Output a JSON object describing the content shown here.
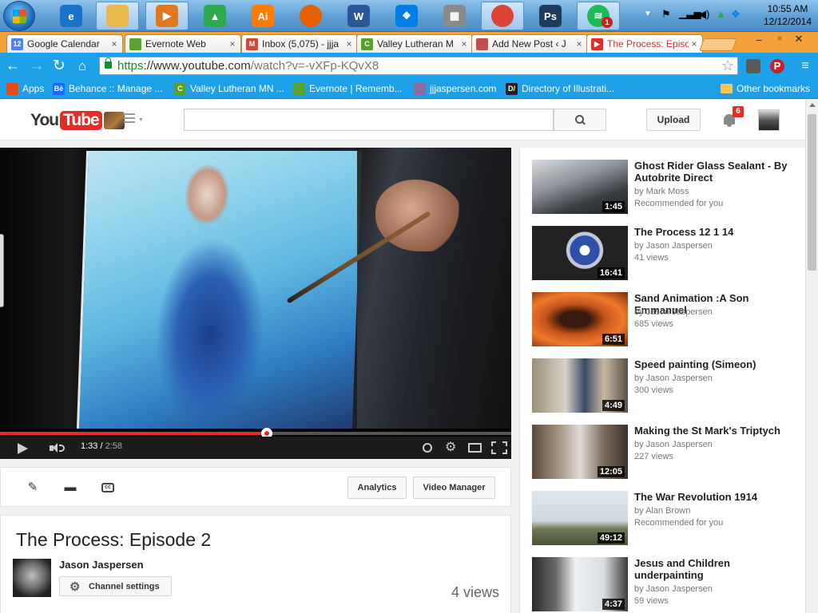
{
  "taskbar": {
    "apps": [
      {
        "name": "ie-icon",
        "glyph": "e",
        "color": "#1a73c8"
      },
      {
        "name": "explorer-icon",
        "glyph": "",
        "color": "#e8b84a"
      },
      {
        "name": "media-player-icon",
        "glyph": "▶",
        "color": "#e07820"
      },
      {
        "name": "google-drive-icon",
        "glyph": "▲",
        "color": "#2da94f"
      },
      {
        "name": "illustrator-icon",
        "glyph": "Ai",
        "color": "#ff7c00"
      },
      {
        "name": "firefox-icon",
        "glyph": "",
        "color": "#e66000"
      },
      {
        "name": "word-icon",
        "glyph": "W",
        "color": "#2b579a"
      },
      {
        "name": "dropbox-icon",
        "glyph": "❖",
        "color": "#007ee5"
      },
      {
        "name": "calculator-icon",
        "glyph": "▦",
        "color": "#8a8a8a"
      },
      {
        "name": "chrome-icon",
        "glyph": "",
        "color": "#db4437"
      },
      {
        "name": "photoshop-icon",
        "glyph": "Ps",
        "color": "#1f3c5c"
      },
      {
        "name": "spotify-icon",
        "glyph": "≋",
        "color": "#1db954"
      }
    ],
    "spotify_badge": "1",
    "clock_time": "10:55 AM",
    "clock_date": "12/12/2014"
  },
  "tabs": [
    {
      "label": "Google Calendar",
      "favicon": "12",
      "color": "#4a86e8"
    },
    {
      "label": "Evernote Web",
      "favicon": "",
      "color": "#58a52e"
    },
    {
      "label": "Inbox (5,075) - jjja",
      "favicon": "M",
      "color": "#d44638"
    },
    {
      "label": "Valley Lutheran M",
      "favicon": "C",
      "color": "#5aa02c"
    },
    {
      "label": "Add New Post ‹ J",
      "favicon": "",
      "color": "#c0504d"
    },
    {
      "label": "The Process: Episo",
      "favicon": "▶",
      "color": "#e52d27",
      "active": true
    }
  ],
  "toolbar": {
    "url_scheme": "https",
    "url_rest": "://www.youtube.com",
    "url_path": "/watch?v=-vXFp-KQvX8"
  },
  "bookmarks": [
    {
      "label": "Apps",
      "favicon": "",
      "color": "#e64a19"
    },
    {
      "label": "Behance :: Manage ...",
      "favicon": "Bē",
      "color": "#1769ff"
    },
    {
      "label": "Valley Lutheran MN ...",
      "favicon": "C",
      "color": "#5aa02c"
    },
    {
      "label": "Evernote | Rememb...",
      "favicon": "",
      "color": "#58a52e"
    },
    {
      "label": "jjjaspersen.com",
      "favicon": "",
      "color": "#8a6d9c"
    },
    {
      "label": "Directory of Illustrati...",
      "favicon": "D/",
      "color": "#222222"
    }
  ],
  "other_bookmarks": "Other bookmarks",
  "youtube": {
    "logo_you": "You",
    "logo_tube": "Tube",
    "search_placeholder": "",
    "upload_label": "Upload",
    "notification_count": "6"
  },
  "player": {
    "current_time": "1:33",
    "duration": "2:58",
    "progress_fraction": 0.522
  },
  "actions": {
    "analytics_label": "Analytics",
    "video_manager_label": "Video Manager"
  },
  "video": {
    "title": "The Process: Episode 2",
    "channel": "Jason Jaspersen",
    "channel_settings_label": "Channel settings",
    "views": "4 views"
  },
  "recommendations": [
    {
      "title": "Ghost Rider Glass Sealant - By Autobrite Direct",
      "channel": "by Mark Moss",
      "meta": "Recommended for you",
      "duration": "1:45",
      "thumb": "linear-gradient(160deg,#d9dde0 0%,#8c9299 40%,#3b3f44 70%,#1b1d20 100%)"
    },
    {
      "title": "The Process 12 1 14",
      "channel": "by Jason Jaspersen",
      "meta": "41 views",
      "duration": "16:41",
      "thumb": "radial-gradient(circle at 55% 45%,#fff 0 8%,#2f4fa8 9% 24%,#c2c8d8 25% 30%,#222 31%)"
    },
    {
      "title": "Sand Animation :A Son Emmanuel",
      "channel": "by Jason Jaspersen",
      "meta": "685 views",
      "duration": "6:51",
      "thumb": "radial-gradient(ellipse at 45% 50%,#3a1a0c 0 20%,#c2531c 40%,#f07a2a 65%,#7a2a0c 100%)"
    },
    {
      "title": "Speed painting (Simeon)",
      "channel": "by Jason Jaspersen",
      "meta": "300 views",
      "duration": "4:49",
      "thumb": "linear-gradient(90deg,#9c8f7c 0%,#d8d2c4 35%,#3a4a66 55%,#c8b8a0 75%,#5c5044 100%)"
    },
    {
      "title": "Making the St Mark's Triptych",
      "channel": "by Jason Jaspersen",
      "meta": "227 views",
      "duration": "12:05",
      "thumb": "linear-gradient(90deg,#5c4a3c 0%,#a89a88 30%,#e0dcd6 50%,#7a6a5a 75%,#3c3028 100%)"
    },
    {
      "title": "The War Revolution 1914",
      "channel": "by Alan Brown",
      "meta": "Recommended for you",
      "duration": "49:12",
      "thumb": "linear-gradient(180deg,#dfe6ee 0%,#cfd8e0 55%,#6f7a58 70%,#4a5438 100%)"
    },
    {
      "title": "Jesus and Children underpainting",
      "channel": "by Jason Jaspersen",
      "meta": "59 views",
      "duration": "4:37",
      "thumb": "linear-gradient(90deg,#2a2a2a 0%,#6a6a6a 25%,#eef0f2 45%,#d8dde2 75%,#3a3a3a 100%)"
    }
  ]
}
